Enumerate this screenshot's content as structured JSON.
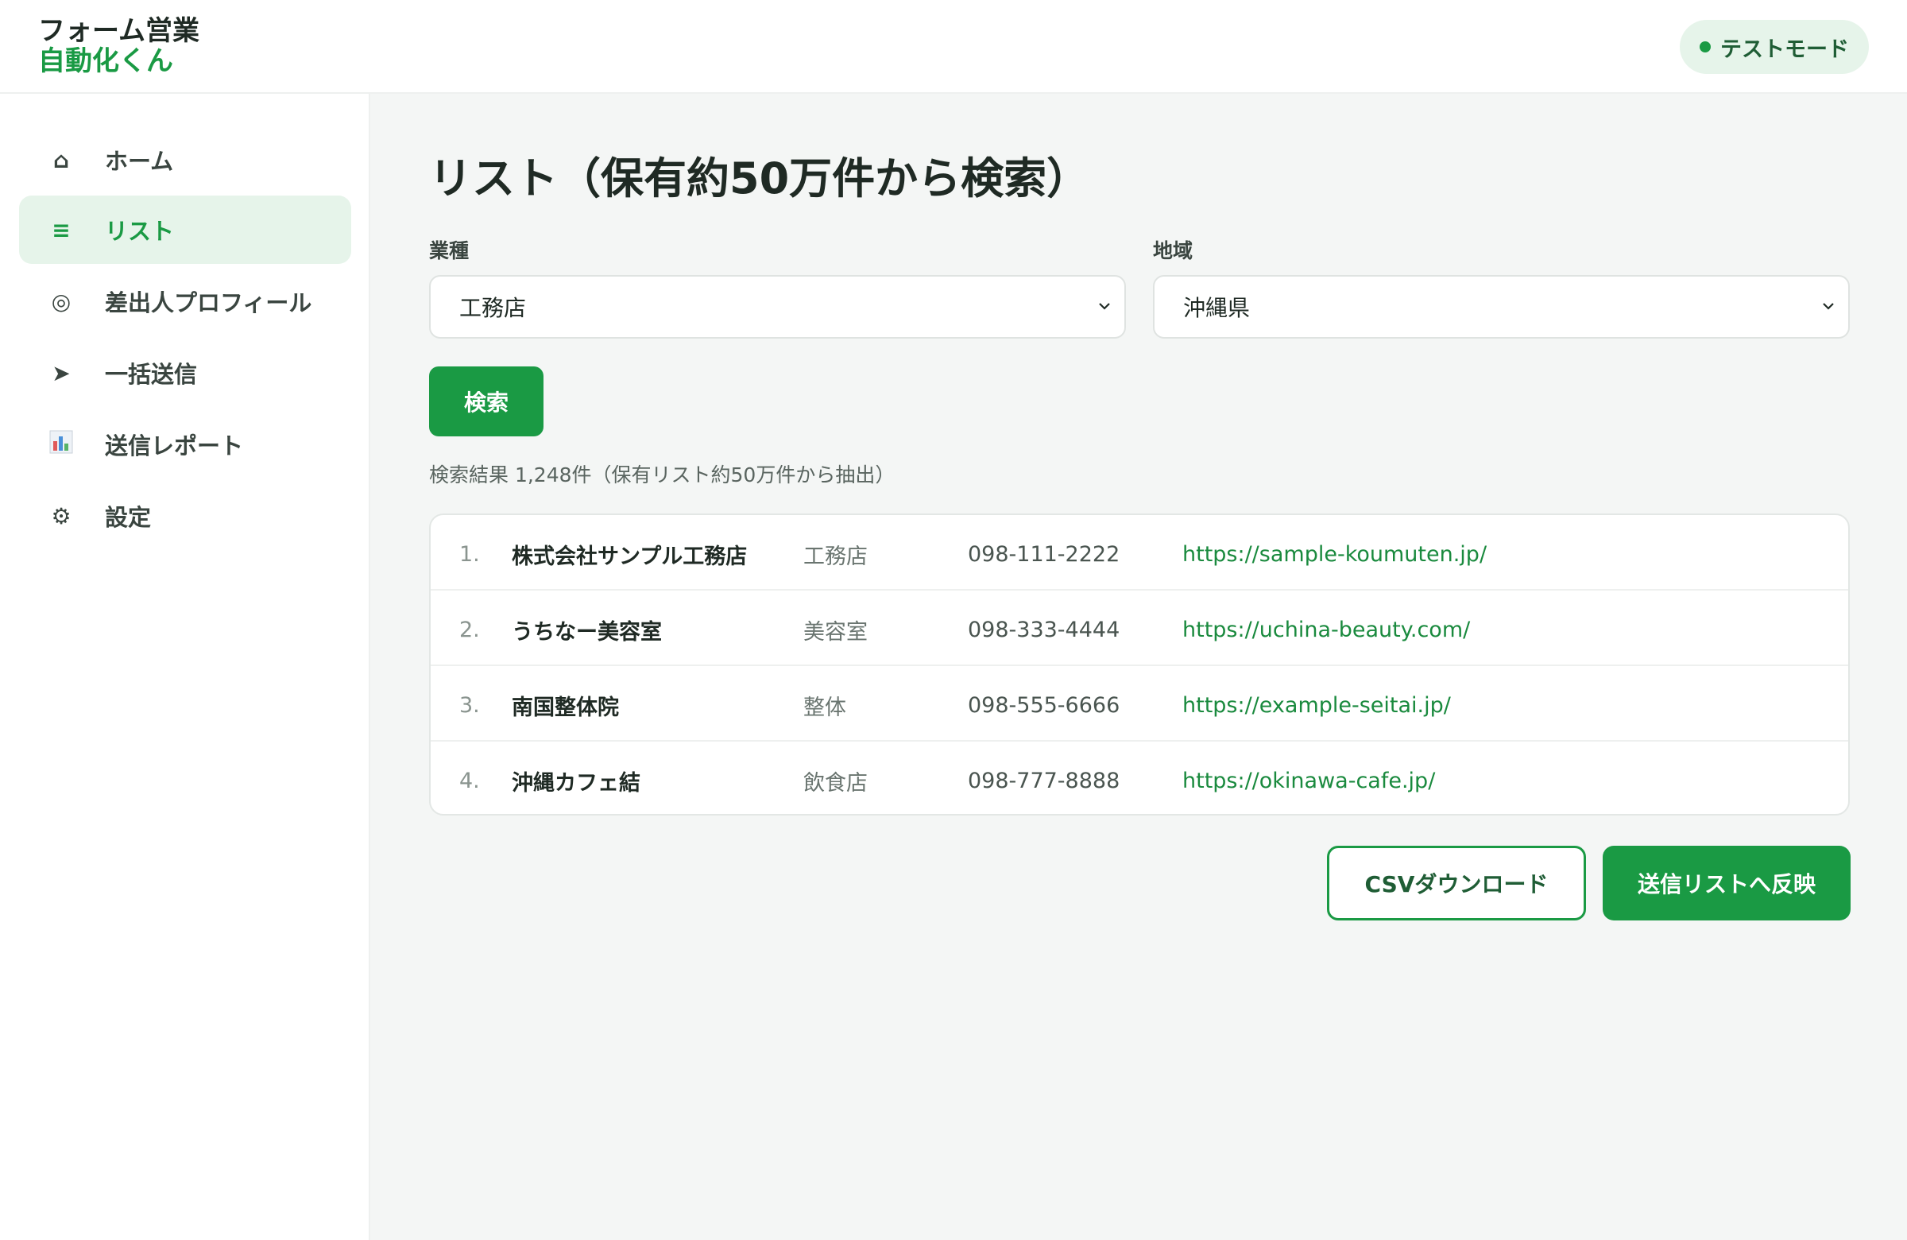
{
  "app": {
    "logo_line1": "フォーム営業",
    "logo_line2": "自動化くん",
    "mode_badge": "テストモード"
  },
  "sidebar": {
    "items": [
      {
        "label": "ホーム",
        "icon": "home-icon",
        "glyph": "⌂"
      },
      {
        "label": "リスト",
        "icon": "list-icon",
        "glyph": "≡"
      },
      {
        "label": "差出人プロフィール",
        "icon": "profile-icon",
        "glyph": "◎"
      },
      {
        "label": "一括送信",
        "icon": "send-icon",
        "glyph": "➤"
      },
      {
        "label": "送信レポート",
        "icon": "report-chart-icon",
        "glyph": "📊"
      },
      {
        "label": "設定",
        "icon": "gear-icon",
        "glyph": "⚙"
      }
    ],
    "active_index": 1
  },
  "main": {
    "title": "リスト（保有約50万件から検索）",
    "filters": {
      "industry_label": "業種",
      "industry_value": "工務店",
      "region_label": "地域",
      "region_value": "沖縄県"
    },
    "search_button": "検索",
    "result_summary": "検索結果 1,248件（保有リスト約50万件から抽出）",
    "results": [
      {
        "num": "1.",
        "name": "株式会社サンプル工務店",
        "category": "工務店",
        "phone": "098-111-2222",
        "url": "https://sample-koumuten.jp/"
      },
      {
        "num": "2.",
        "name": "うちなー美容室",
        "category": "美容室",
        "phone": "098-333-4444",
        "url": "https://uchina-beauty.com/"
      },
      {
        "num": "3.",
        "name": "南国整体院",
        "category": "整体",
        "phone": "098-555-6666",
        "url": "https://example-seitai.jp/"
      },
      {
        "num": "4.",
        "name": "沖縄カフェ結",
        "category": "飲食店",
        "phone": "098-777-8888",
        "url": "https://okinawa-cafe.jp/"
      }
    ],
    "csv_button": "CSVダウンロード",
    "apply_button": "送信リストへ反映"
  },
  "colors": {
    "accent": "#1a9a44",
    "accent_light": "#e6f4ea",
    "background": "#f4f6f5"
  }
}
